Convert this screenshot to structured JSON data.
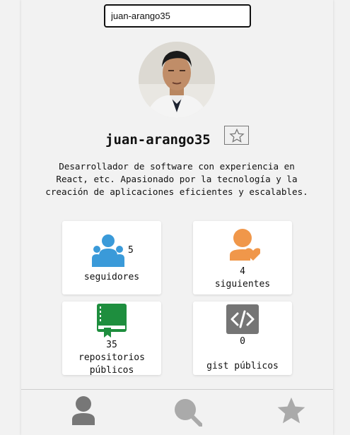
{
  "search": {
    "value": "juan-arango35"
  },
  "profile": {
    "username": "juan-arango35",
    "bio": "Desarrollador de software con experiencia en React, etc. Apasionado por la tecnología y la creación de aplicaciones eficientes y escalables."
  },
  "stats": {
    "followers": {
      "count": "5",
      "label": "seguidores",
      "icon": "people-icon",
      "color": "#3a9ad9"
    },
    "following": {
      "count": "4",
      "label": "siguientes",
      "icon": "person-heart-icon",
      "color": "#f0974a"
    },
    "repos": {
      "count": "35",
      "label_line1": "repositorios",
      "label_line2": "públicos",
      "icon": "repo-book-icon",
      "color": "#1e8e3e"
    },
    "gists": {
      "count": "0",
      "label": "gist públicos",
      "icon": "code-icon",
      "color": "#757575"
    }
  },
  "nav": {
    "items": [
      "user-icon",
      "search-icon",
      "star-icon"
    ],
    "color": "#aaaaaa"
  }
}
